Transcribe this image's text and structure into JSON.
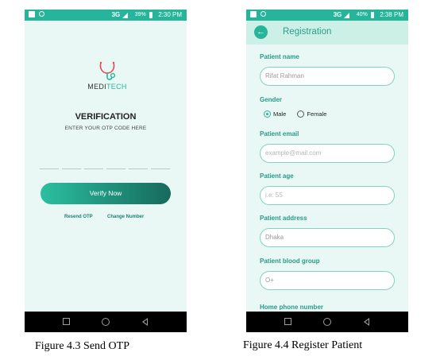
{
  "statusbar_left": {
    "network": "3G",
    "battery": "39%",
    "time": "2:30 PM"
  },
  "statusbar_right": {
    "network": "3G",
    "battery": "40%",
    "time": "2:38 PM"
  },
  "otp_screen": {
    "logo": {
      "part1": "MEDI",
      "part2": "TECH"
    },
    "title": "VERIFICATION",
    "subtitle": "ENTER YOUR OTP CODE HERE",
    "otp_digits": 6,
    "verify_button": "Verify Now",
    "resend_link": "Resend OTP",
    "change_number_link": "Change Number"
  },
  "register_screen": {
    "title": "Registration",
    "patient_name": {
      "label": "Patient name",
      "value": "Rifat Rahman"
    },
    "gender": {
      "label": "Gender",
      "options": [
        "Male",
        "Female"
      ],
      "selected": "Male"
    },
    "patient_email": {
      "label": "Patient email",
      "placeholder": "example@mail.com"
    },
    "patient_age": {
      "label": "Patient age",
      "placeholder": "i.e: 55"
    },
    "patient_address": {
      "label": "Patient address",
      "value": "Dhaka"
    },
    "blood_group": {
      "label": "Patient blood group",
      "value": "O+"
    },
    "home_phone": {
      "label": "Home phone number"
    }
  },
  "captions": {
    "left": "Figure 4.3 Send OTP",
    "right": "Figure 4.4 Register Patient"
  },
  "colors": {
    "accent": "#26b59b",
    "accent_dark": "#17695c",
    "screen_bg": "#e9f8f4"
  }
}
